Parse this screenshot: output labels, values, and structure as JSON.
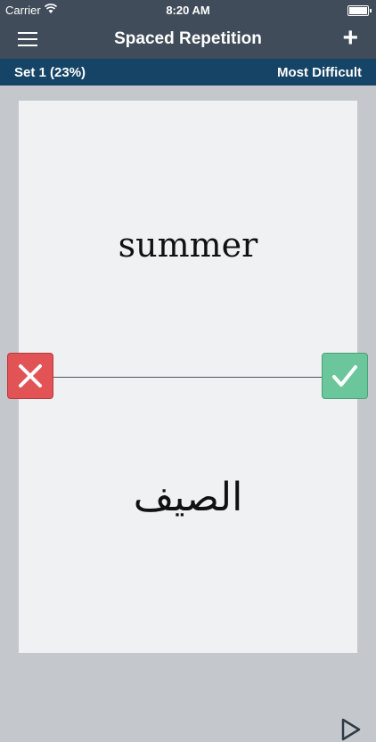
{
  "status": {
    "carrier": "Carrier",
    "time": "8:20 AM",
    "battery_level": 1.0
  },
  "nav": {
    "title": "Spaced Repetition",
    "menu_icon": "hamburger-icon",
    "add_icon": "plus-icon",
    "add_label": "+"
  },
  "set": {
    "name": "Set 1 (23%)",
    "mode": "Most Difficult"
  },
  "card": {
    "front": "summer",
    "back": "الصيف"
  },
  "actions": {
    "wrong_icon": "x-icon",
    "right_icon": "checkmark-icon",
    "play_icon": "play-icon"
  },
  "colors": {
    "nav": "#404c59",
    "setbar": "#154466",
    "wrong": "#e15355",
    "right": "#6cc69c",
    "card": "#eff1f2"
  }
}
